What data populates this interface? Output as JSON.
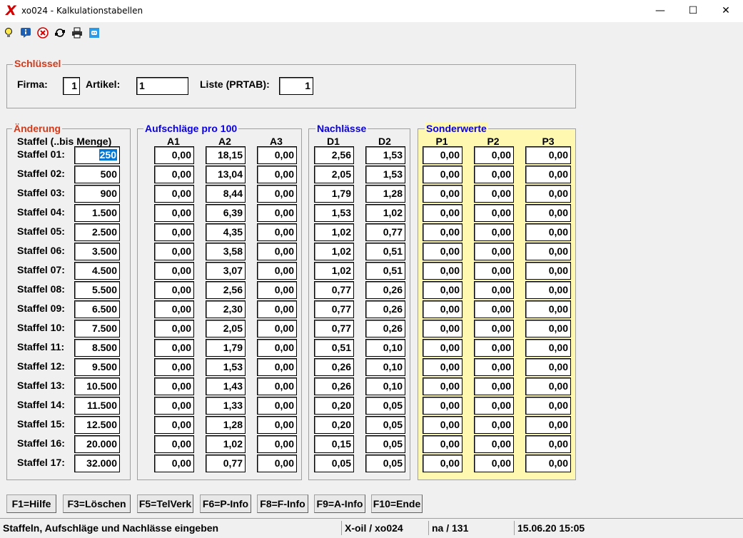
{
  "window": {
    "title": "xo024 - Kalkulationstabellen",
    "app_icon_glyph": "X",
    "minimize": "—",
    "maximize": "☐",
    "close": "✕"
  },
  "toolbar": {
    "icons": [
      "lightbulb-icon",
      "info-icon",
      "stop-icon",
      "refresh-icon",
      "printer-icon",
      "chat-icon"
    ]
  },
  "schluessel": {
    "title": "Schlüssel",
    "firma_label": "Firma:",
    "firma_value": "1",
    "artikel_label": "Artikel:",
    "artikel_value": "1",
    "liste_label": "Liste (PRTAB):",
    "liste_value": "1"
  },
  "aenderung": {
    "title": "Änderung",
    "header": "Staffel (..bis Menge)",
    "rows": [
      {
        "label": "Staffel 01:",
        "value": "250"
      },
      {
        "label": "Staffel 02:",
        "value": "500"
      },
      {
        "label": "Staffel 03:",
        "value": "900"
      },
      {
        "label": "Staffel 04:",
        "value": "1.500"
      },
      {
        "label": "Staffel 05:",
        "value": "2.500"
      },
      {
        "label": "Staffel 06:",
        "value": "3.500"
      },
      {
        "label": "Staffel 07:",
        "value": "4.500"
      },
      {
        "label": "Staffel 08:",
        "value": "5.500"
      },
      {
        "label": "Staffel 09:",
        "value": "6.500"
      },
      {
        "label": "Staffel 10:",
        "value": "7.500"
      },
      {
        "label": "Staffel 11:",
        "value": "8.500"
      },
      {
        "label": "Staffel 12:",
        "value": "9.500"
      },
      {
        "label": "Staffel 13:",
        "value": "10.500"
      },
      {
        "label": "Staffel 14:",
        "value": "11.500"
      },
      {
        "label": "Staffel 15:",
        "value": "12.500"
      },
      {
        "label": "Staffel 16:",
        "value": "20.000"
      },
      {
        "label": "Staffel 17:",
        "value": "32.000"
      }
    ]
  },
  "aufschlaege": {
    "title": "Aufschläge pro 100",
    "columns": [
      "A1",
      "A2",
      "A3"
    ],
    "rows": [
      [
        "0,00",
        "18,15",
        "0,00"
      ],
      [
        "0,00",
        "13,04",
        "0,00"
      ],
      [
        "0,00",
        "8,44",
        "0,00"
      ],
      [
        "0,00",
        "6,39",
        "0,00"
      ],
      [
        "0,00",
        "4,35",
        "0,00"
      ],
      [
        "0,00",
        "3,58",
        "0,00"
      ],
      [
        "0,00",
        "3,07",
        "0,00"
      ],
      [
        "0,00",
        "2,56",
        "0,00"
      ],
      [
        "0,00",
        "2,30",
        "0,00"
      ],
      [
        "0,00",
        "2,05",
        "0,00"
      ],
      [
        "0,00",
        "1,79",
        "0,00"
      ],
      [
        "0,00",
        "1,53",
        "0,00"
      ],
      [
        "0,00",
        "1,43",
        "0,00"
      ],
      [
        "0,00",
        "1,33",
        "0,00"
      ],
      [
        "0,00",
        "1,28",
        "0,00"
      ],
      [
        "0,00",
        "1,02",
        "0,00"
      ],
      [
        "0,00",
        "0,77",
        "0,00"
      ]
    ]
  },
  "nachlaesse": {
    "title": "Nachlässe",
    "columns": [
      "D1",
      "D2"
    ],
    "rows": [
      [
        "2,56",
        "1,53"
      ],
      [
        "2,05",
        "1,53"
      ],
      [
        "1,79",
        "1,28"
      ],
      [
        "1,53",
        "1,02"
      ],
      [
        "1,02",
        "0,77"
      ],
      [
        "1,02",
        "0,51"
      ],
      [
        "1,02",
        "0,51"
      ],
      [
        "0,77",
        "0,26"
      ],
      [
        "0,77",
        "0,26"
      ],
      [
        "0,77",
        "0,26"
      ],
      [
        "0,51",
        "0,10"
      ],
      [
        "0,26",
        "0,10"
      ],
      [
        "0,26",
        "0,10"
      ],
      [
        "0,20",
        "0,05"
      ],
      [
        "0,20",
        "0,05"
      ],
      [
        "0,15",
        "0,05"
      ],
      [
        "0,05",
        "0,05"
      ]
    ]
  },
  "sonderwerte": {
    "title": "Sonderwerte",
    "background": "#fff8b0",
    "columns": [
      "P1",
      "P2",
      "P3"
    ],
    "rows": [
      [
        "0,00",
        "0,00",
        "0,00"
      ],
      [
        "0,00",
        "0,00",
        "0,00"
      ],
      [
        "0,00",
        "0,00",
        "0,00"
      ],
      [
        "0,00",
        "0,00",
        "0,00"
      ],
      [
        "0,00",
        "0,00",
        "0,00"
      ],
      [
        "0,00",
        "0,00",
        "0,00"
      ],
      [
        "0,00",
        "0,00",
        "0,00"
      ],
      [
        "0,00",
        "0,00",
        "0,00"
      ],
      [
        "0,00",
        "0,00",
        "0,00"
      ],
      [
        "0,00",
        "0,00",
        "0,00"
      ],
      [
        "0,00",
        "0,00",
        "0,00"
      ],
      [
        "0,00",
        "0,00",
        "0,00"
      ],
      [
        "0,00",
        "0,00",
        "0,00"
      ],
      [
        "0,00",
        "0,00",
        "0,00"
      ],
      [
        "0,00",
        "0,00",
        "0,00"
      ],
      [
        "0,00",
        "0,00",
        "0,00"
      ],
      [
        "0,00",
        "0,00",
        "0,00"
      ]
    ]
  },
  "function_keys": [
    "F1=Hilfe",
    "F3=Löschen",
    "F5=TelVerk",
    "F6=P-Info",
    "F8=F-Info",
    "F9=A-Info",
    "F10=Ende"
  ],
  "status": {
    "message": "Staffeln, Aufschläge und Nachlässe eingeben",
    "program": "X-oil / xo024",
    "user": "na / 131",
    "datetime": "15.06.20 15:05"
  }
}
